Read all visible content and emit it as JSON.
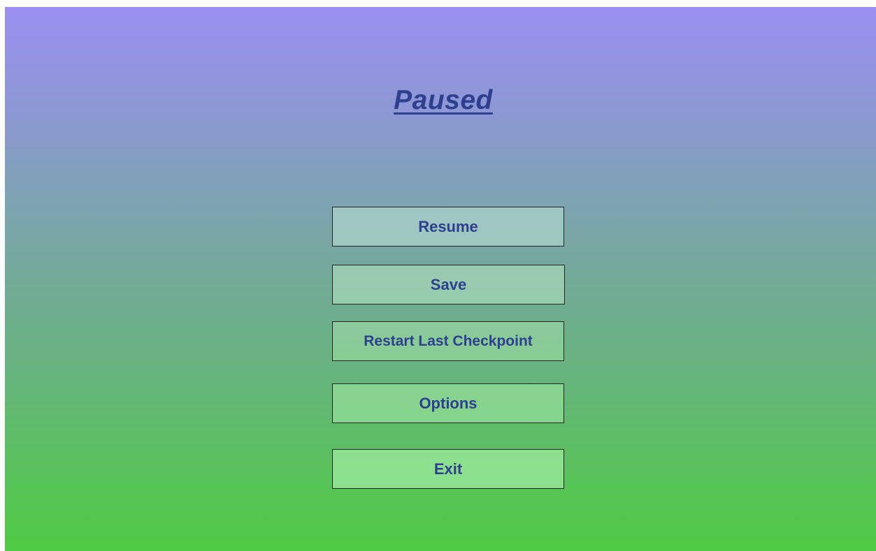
{
  "pause_menu": {
    "title": "Paused",
    "buttons": {
      "resume": "Resume",
      "save": "Save",
      "restart": "Restart Last Checkpoint",
      "options": "Options",
      "exit": "Exit"
    }
  },
  "colors": {
    "text": "#2f3f8f",
    "gradient_top": "#9b90f2",
    "gradient_bottom": "#4fca43",
    "button_border": "#252525"
  }
}
